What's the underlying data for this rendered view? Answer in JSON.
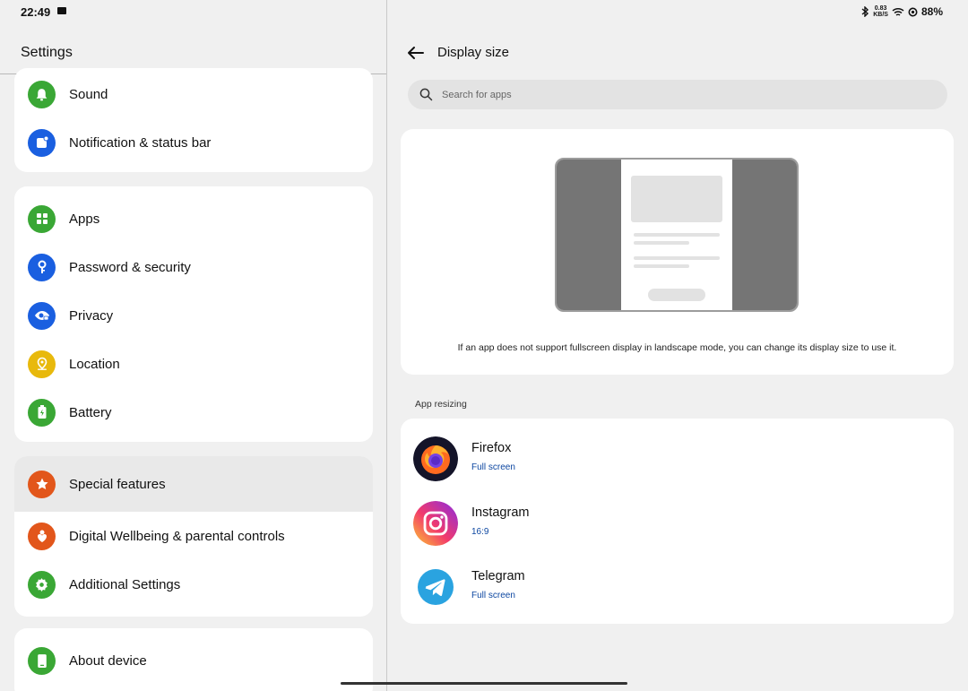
{
  "status_bar": {
    "time": "22:49",
    "speed_top": "0.83",
    "speed_bottom": "KB/S",
    "battery": "88%"
  },
  "left": {
    "title": "Settings",
    "card1": [
      {
        "label": "Sound",
        "icon": "bell-icon",
        "color": "#3aa735"
      },
      {
        "label": "Notification & status bar",
        "icon": "notification-icon",
        "color": "#1a5fe0"
      }
    ],
    "card2": [
      {
        "label": "Apps",
        "icon": "apps-grid-icon",
        "color": "#3aa735"
      },
      {
        "label": "Password & security",
        "icon": "key-icon",
        "color": "#1a5fe0"
      },
      {
        "label": "Privacy",
        "icon": "eye-lock-icon",
        "color": "#1a5fe0"
      },
      {
        "label": "Location",
        "icon": "location-icon",
        "color": "#e8b90c"
      },
      {
        "label": "Battery",
        "icon": "battery-icon",
        "color": "#3aa735"
      }
    ],
    "card3": [
      {
        "label": "Special features",
        "icon": "star-icon",
        "color": "#e2561b"
      },
      {
        "label": "Digital Wellbeing & parental controls",
        "icon": "heart-person-icon",
        "color": "#e2561b"
      },
      {
        "label": "Additional Settings",
        "icon": "gear-icon",
        "color": "#3aa735"
      }
    ],
    "card4": [
      {
        "label": "About device",
        "icon": "phone-icon",
        "color": "#3aa735"
      }
    ]
  },
  "right": {
    "title": "Display size",
    "search_placeholder": "Search for apps",
    "illustration_caption": "If an app does not support fullscreen display in landscape mode, you can change its display size to use it.",
    "section_label": "App resizing",
    "apps": [
      {
        "name": "Firefox",
        "mode": "Full screen",
        "icon": "firefox-icon"
      },
      {
        "name": "Instagram",
        "mode": "16:9",
        "icon": "instagram-icon"
      },
      {
        "name": "Telegram",
        "mode": "Full screen",
        "icon": "telegram-icon"
      }
    ]
  }
}
